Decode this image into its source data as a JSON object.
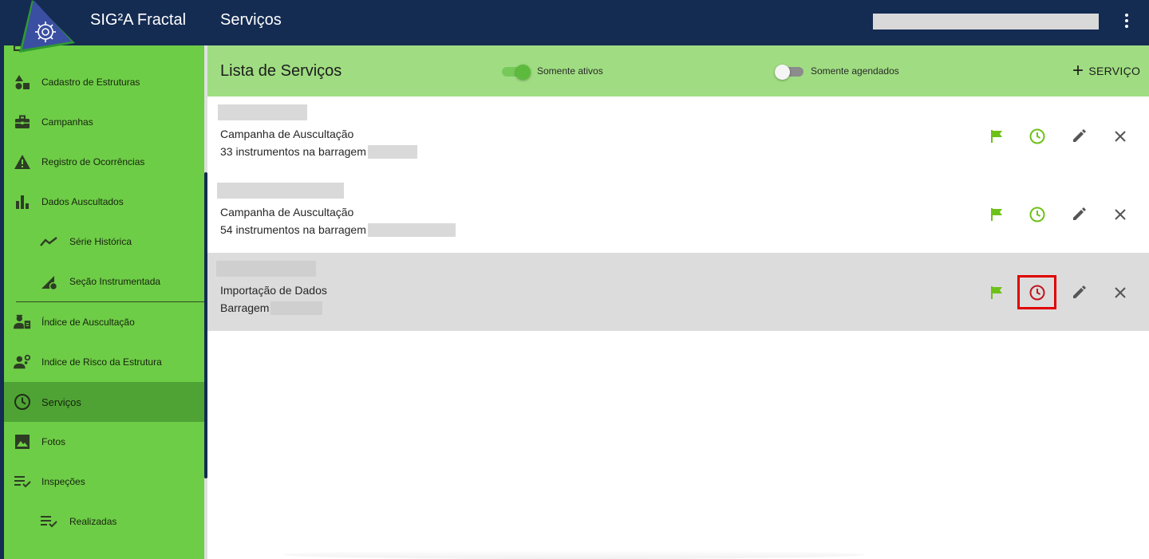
{
  "app": {
    "title": "SIG²A Fractal",
    "page_title": "Serviços"
  },
  "sidebar": {
    "items": [
      {
        "label": "Cadastro de Estruturas",
        "icon": "shapes-icon"
      },
      {
        "label": "Campanhas",
        "icon": "briefcase-icon"
      },
      {
        "label": "Registro de Ocorrências",
        "icon": "warning-icon"
      },
      {
        "label": "Dados Auscultados",
        "icon": "bar-chart-icon"
      },
      {
        "label": "Série Histórica",
        "icon": "trend-line-icon"
      },
      {
        "label": "Seção Instrumentada",
        "icon": "ruler-gear-icon"
      },
      {
        "label": "Índice de Auscultação",
        "icon": "engineer-clipboard-icon"
      },
      {
        "label": "Indice de Risco da Estrutura",
        "icon": "engineer-settings-icon"
      },
      {
        "label": "Serviços",
        "icon": "clock-icon"
      },
      {
        "label": "Fotos",
        "icon": "image-icon"
      },
      {
        "label": "Inspeções",
        "icon": "checklist-icon"
      },
      {
        "label": "Realizadas",
        "icon": "checklist-icon"
      }
    ]
  },
  "list": {
    "title": "Lista de Serviços",
    "toggle_active_label": "Somente ativos",
    "toggle_active_on": true,
    "toggle_scheduled_label": "Somente agendados",
    "toggle_scheduled_on": false,
    "add_label": "SERVIÇO",
    "rows": [
      {
        "type": "Campanha de Auscultação",
        "detail": "33 instrumentos na barragem"
      },
      {
        "type": "Campanha de Auscultação",
        "detail": "54 instrumentos na barragem"
      },
      {
        "type": "Importação de Dados",
        "detail": "Barragem"
      }
    ]
  },
  "colors": {
    "topbar": "#142b52",
    "sidebar": "#6ecd47",
    "sidebar_active": "#4ea334",
    "header": "#a0dd82",
    "icon_green": "#6ec118",
    "icon_red": "#c0141b",
    "focus_border": "#e00000"
  }
}
